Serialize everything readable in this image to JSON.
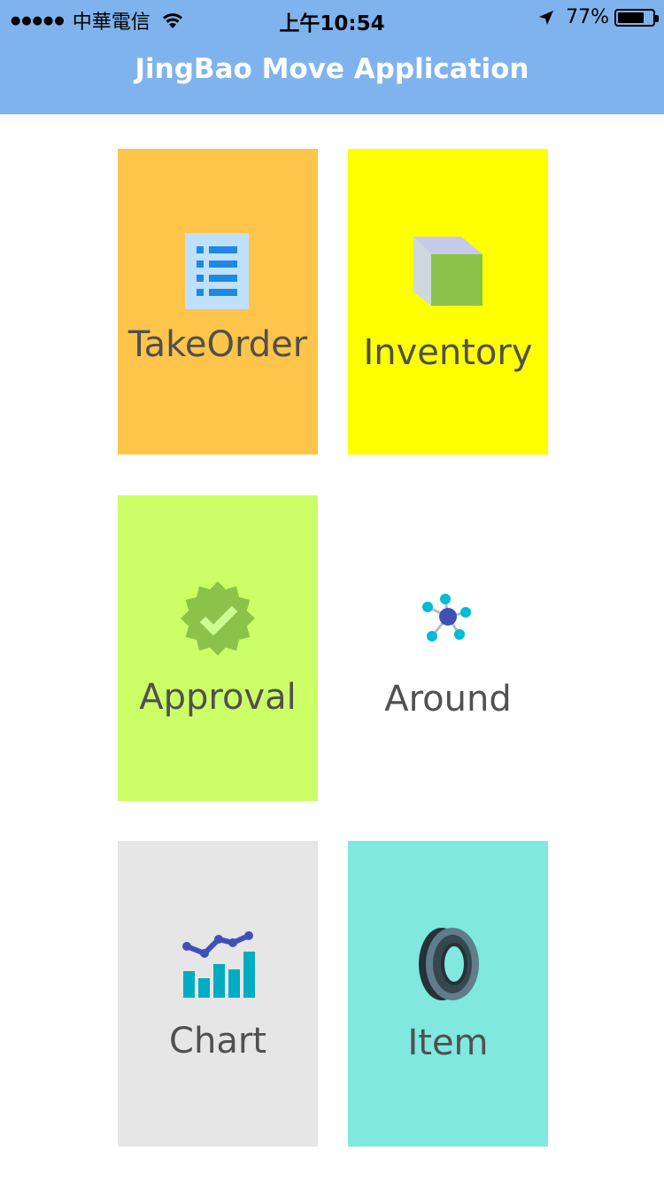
{
  "status_bar": {
    "signal_dots": "●●●●●",
    "carrier": "中華電信",
    "time": "上午10:54",
    "battery_text": "77%",
    "battery_level": 0.77
  },
  "header": {
    "title": "JingBao Move Application",
    "background": "#7fb3ed"
  },
  "tiles": [
    {
      "label": "TakeOrder",
      "icon": "list-document-icon",
      "color": "#ffc54a"
    },
    {
      "label": "Inventory",
      "icon": "cube-box-icon",
      "color": "#ffff00"
    },
    {
      "label": "Approval",
      "icon": "verified-badge-icon",
      "color": "#ccff66"
    },
    {
      "label": "Around",
      "icon": "network-nodes-icon",
      "color": "#ffffff"
    },
    {
      "label": "Chart",
      "icon": "bar-line-chart-icon",
      "color": "#e6e6e6"
    },
    {
      "label": "Item",
      "icon": "tire-icon",
      "color": "#80e8de"
    }
  ]
}
